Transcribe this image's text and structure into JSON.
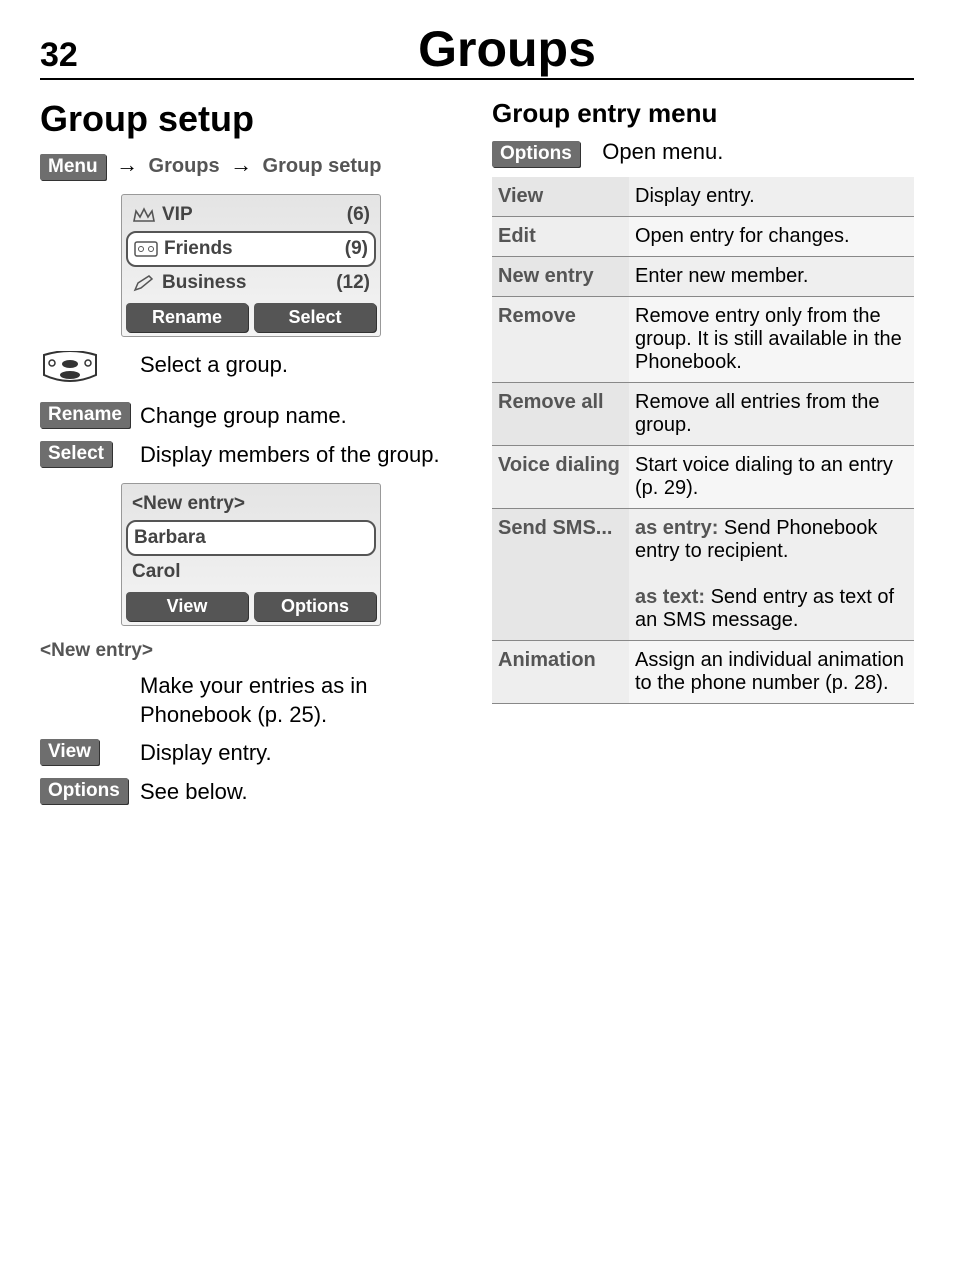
{
  "page_number": "32",
  "page_title": "Groups",
  "left": {
    "section_heading": "Group setup",
    "breadcrumb": {
      "menu": "Menu",
      "arrow": "→",
      "level1": "Groups",
      "level2": "Group setup"
    },
    "screen1": {
      "rows": [
        {
          "icon": "crown-icon",
          "label": "VIP",
          "count": "(6)"
        },
        {
          "icon": "cassette-icon",
          "label": "Friends",
          "count": "(9)",
          "highlight": true
        },
        {
          "icon": "pen-icon",
          "label": "Business",
          "count": "(12)"
        }
      ],
      "soft_left": "Rename",
      "soft_right": "Select"
    },
    "defs": {
      "navkey_text": "Select a group.",
      "rename_label": "Rename",
      "rename_text": "Change group name.",
      "select_label": "Select",
      "select_text": "Display members of the group."
    },
    "screen2": {
      "rows": [
        {
          "label": "<New entry>"
        },
        {
          "label": "Barbara",
          "highlight": true
        },
        {
          "label": "Carol"
        }
      ],
      "soft_left": "View",
      "soft_right": "Options"
    },
    "bottom": {
      "newentry_label": "<New entry>",
      "newentry_text": "Make your entries as in Phonebook (p. 25).",
      "view_label": "View",
      "view_text": "Display entry.",
      "options_label": "Options",
      "options_text": "See below."
    }
  },
  "right": {
    "sub_heading": "Group entry menu",
    "options_label": "Options",
    "options_text": "Open menu.",
    "table": [
      {
        "k": "View",
        "v": "Display entry."
      },
      {
        "k": "Edit",
        "v": "Open entry for changes."
      },
      {
        "k": "New entry",
        "v": "Enter new member."
      },
      {
        "k": "Remove",
        "v": "Remove entry only from the group. It is still available in the Phonebook."
      },
      {
        "k": "Remove all",
        "v": "Remove all entries from the group."
      },
      {
        "k": "Voice dialing",
        "v": "Start voice dialing to an entry (p. 29)."
      },
      {
        "k": "Send SMS...",
        "v_html": true,
        "v_pre1": "as entry:",
        "v_txt1": " Send Phonebook entry to recipient.",
        "v_pre2": "as text:",
        "v_txt2": " Send entry as text of an SMS message."
      },
      {
        "k": "Animation",
        "v": "Assign an individual animation to the phone number (p. 28)."
      }
    ]
  }
}
